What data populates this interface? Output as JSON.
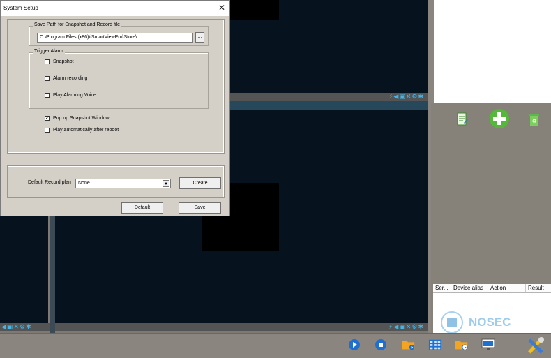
{
  "dialog": {
    "title": "System Setup",
    "close_glyph": "✕",
    "save_path_group": "Save Path for Snapshot and Record file",
    "save_path_value": "C:\\Program Files (x86)\\iSmartViewPro\\Store\\",
    "browse_label": "...",
    "trigger_alarm_group": "Trigger Alarm",
    "snapshot_label": "Snapshot",
    "alarm_recording_label": "Alarm recording",
    "play_alarming_voice_label": "Play Alarming Voice",
    "popup_snapshot_label": "Pop up Snapshot Window",
    "popup_snapshot_checked": true,
    "autoplay_label": "Play automatically after reboot",
    "default_record_plan_label": "Default Record plan",
    "record_plan_value": "None",
    "create_label": "Create",
    "default_label": "Default",
    "save_label": "Save"
  },
  "results_table": {
    "columns": [
      "Ser...",
      "Device alias",
      "Action",
      "Result"
    ]
  },
  "watermark": {
    "text": "NOSEC"
  },
  "colors": {
    "video_pane": "#06121e",
    "accent_blue": "#47b4e6",
    "dialog_face": "#d4d0c8"
  },
  "icons": {
    "pane_controls": [
      "cursor-icon",
      "speaker-icon",
      "camera-icon",
      "close-icon",
      "settings-icon",
      "expand-icon"
    ],
    "right_panel": [
      "edit-document-icon",
      "add-icon",
      "recycle-bin-icon"
    ],
    "taskbar": [
      "play-icon",
      "stop-icon",
      "folder-video-icon",
      "grid-layout-icon",
      "folder-schedule-icon",
      "monitor-icon",
      "tools-icon"
    ]
  }
}
